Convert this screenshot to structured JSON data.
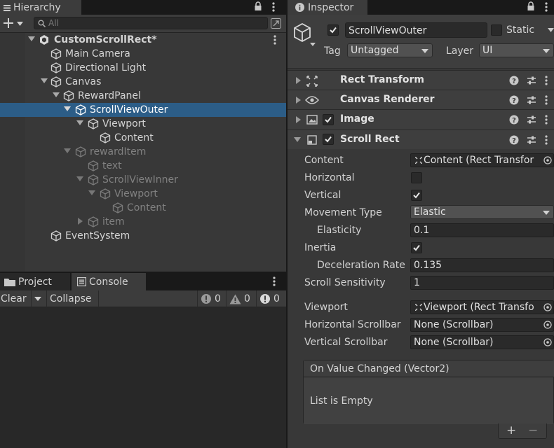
{
  "hierarchy": {
    "tab_label": "Hierarchy",
    "search_placeholder": "All",
    "items": [
      {
        "label": "CustomScrollRect*",
        "depth": 0
      },
      {
        "label": "Main Camera",
        "depth": 1
      },
      {
        "label": "Directional Light",
        "depth": 1
      },
      {
        "label": "Canvas",
        "depth": 1
      },
      {
        "label": "RewardPanel",
        "depth": 2
      },
      {
        "label": "ScrollViewOuter",
        "depth": 3
      },
      {
        "label": "Viewport",
        "depth": 4
      },
      {
        "label": "Content",
        "depth": 5
      },
      {
        "label": "rewardItem",
        "depth": 3
      },
      {
        "label": "text",
        "depth": 4
      },
      {
        "label": "ScrollViewInner",
        "depth": 4
      },
      {
        "label": "Viewport",
        "depth": 5
      },
      {
        "label": "Content",
        "depth": 6
      },
      {
        "label": "item",
        "depth": 5
      },
      {
        "label": "EventSystem",
        "depth": 1
      }
    ]
  },
  "bottom": {
    "tab_project": "Project",
    "tab_console": "Console",
    "clear_label": "Clear",
    "collapse_label": "Collapse",
    "error_count": "0",
    "warning_count": "0",
    "info_count": "0"
  },
  "inspector": {
    "tab_label": "Inspector",
    "object_name": "ScrollViewOuter",
    "static_label": "Static",
    "tag_label": "Tag",
    "tag_value": "Untagged",
    "layer_label": "Layer",
    "layer_value": "UI",
    "components": {
      "rect_transform": "Rect Transform",
      "canvas_renderer": "Canvas Renderer",
      "image": "Image",
      "scroll_rect": "Scroll Rect"
    },
    "scroll_rect": {
      "content_label": "Content",
      "content_value": "Content (Rect Transfor",
      "horizontal_label": "Horizontal",
      "vertical_label": "Vertical",
      "movement_type_label": "Movement Type",
      "movement_type_value": "Elastic",
      "elasticity_label": "Elasticity",
      "elasticity_value": "0.1",
      "inertia_label": "Inertia",
      "deceleration_label": "Deceleration Rate",
      "deceleration_value": "0.135",
      "sensitivity_label": "Scroll Sensitivity",
      "sensitivity_value": "1",
      "viewport_label": "Viewport",
      "viewport_value": "Viewport (Rect Transfo",
      "hscroll_label": "Horizontal Scrollbar",
      "hscroll_value": "None (Scrollbar)",
      "vscroll_label": "Vertical Scrollbar",
      "vscroll_value": "None (Scrollbar)",
      "event_title": "On Value Changed (Vector2)",
      "event_empty": "List is Empty",
      "add_label": "+",
      "remove_label": "−"
    }
  },
  "colors": {
    "selection": "#2c5d87",
    "panel": "#383838",
    "field": "#2a2a2a"
  }
}
